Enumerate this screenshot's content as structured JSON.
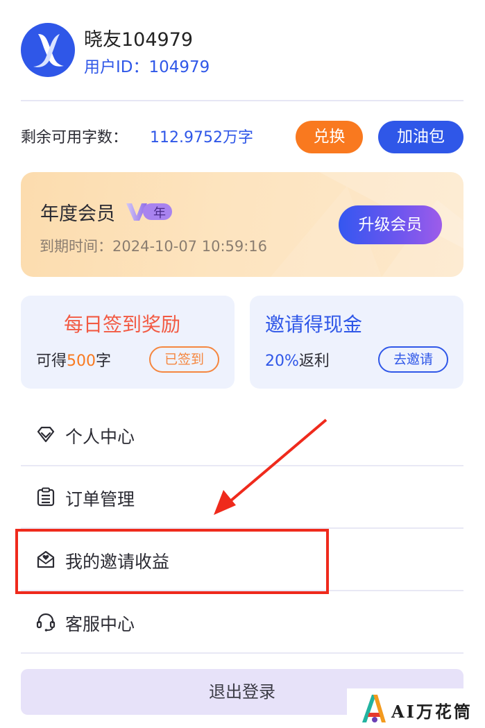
{
  "user": {
    "name": "晓友104979",
    "id_text": "用户ID：104979",
    "avatar_icon": "x-logo-icon"
  },
  "quota": {
    "label": "剩余可用字数：",
    "value": "112.9752万字",
    "exchange_label": "兑换",
    "fuel_label": "加油包"
  },
  "membership": {
    "title": "年度会员",
    "badge_text": "年",
    "expiry": "到期时间：2024-10-07 10:59:16",
    "upgrade_label": "升级会员"
  },
  "checkin": {
    "title": "每日签到奖励",
    "sub_prefix": "可得",
    "sub_amount": "500",
    "sub_suffix": "字",
    "button_label": "已签到"
  },
  "invite": {
    "title": "邀请得现金",
    "sub_rate": "20%",
    "sub_suffix": "返利",
    "button_label": "去邀请"
  },
  "menu": [
    {
      "label": "个人中心",
      "icon": "diamond-icon"
    },
    {
      "label": "订单管理",
      "icon": "clipboard-list-icon"
    },
    {
      "label": "我的邀请收益",
      "icon": "heart-envelope-icon"
    },
    {
      "label": "客服中心",
      "icon": "headset-icon"
    }
  ],
  "logout_label": "退出登录",
  "watermark": {
    "text": "AI万花筒"
  },
  "colors": {
    "brand_blue": "#2f57e8",
    "orange": "#f9791f",
    "annotation_red": "#ef2a1c"
  }
}
